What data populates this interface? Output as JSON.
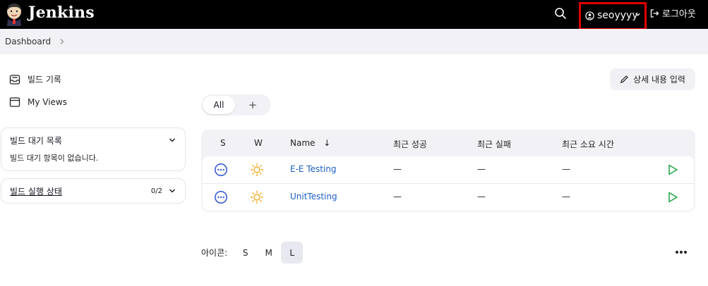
{
  "header": {
    "brand": "Jenkins",
    "username": "seoyyyy",
    "logout_label": "로그아웃"
  },
  "breadcrumb": {
    "items": [
      "Dashboard"
    ]
  },
  "sidebar": {
    "items": [
      {
        "label": "빌드 기록",
        "icon": "inbox-icon"
      },
      {
        "label": "My Views",
        "icon": "window-icon"
      }
    ],
    "build_queue": {
      "title": "빌드 대기 목록",
      "empty_text": "빌드 대기 항목이 없습니다."
    },
    "executor_status": {
      "title": "빌드 실행 상태",
      "count": "0/2"
    }
  },
  "main": {
    "description_button": "상세 내용 입력",
    "tabs": [
      {
        "label": "All"
      },
      {
        "label": "+"
      }
    ],
    "table": {
      "headers": {
        "s": "S",
        "w": "W",
        "name": "Name",
        "name_sort": "↓",
        "last_success": "최근 성공",
        "last_failure": "최근 실패",
        "last_duration": "최근 소요 시간"
      },
      "rows": [
        {
          "name": "E-E Testing",
          "last_success": "—",
          "last_failure": "—",
          "last_duration": "—"
        },
        {
          "name": "UnitTesting",
          "last_success": "—",
          "last_failure": "—",
          "last_duration": "—"
        }
      ]
    },
    "icon_size": {
      "label": "아이콘:",
      "options": [
        "S",
        "M",
        "L"
      ],
      "selected": "L"
    }
  },
  "colors": {
    "header_bg": "#000000",
    "highlight_border": "#e00000",
    "link": "#1b5fc4",
    "weather_sun": "#f0a81c",
    "build_run": "#1ea446",
    "status_not_built": "#3b5bd6"
  }
}
